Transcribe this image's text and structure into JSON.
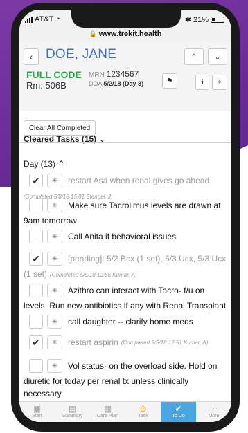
{
  "status_bar": {
    "carrier": "AT&T",
    "battery": "21%"
  },
  "browser": {
    "url": "www.trekit.health"
  },
  "patient": {
    "name": "DOE, JANE",
    "code_status": "FULL CODE",
    "room": "Rm: 506B",
    "mrn_label": "MRN",
    "mrn": "1234567",
    "doa_label": "DOA",
    "doa": "5/2/18 (Day 8)"
  },
  "actions": {
    "clear_all": "Clear All Completed"
  },
  "sections": {
    "cleared": "Cleared Tasks (15)",
    "day": "Day (13)"
  },
  "tasks": [
    {
      "checked": true,
      "done": true,
      "line1": "restart Asa when renal gives go ahead",
      "rest": "",
      "note": "(Completed 5/8/18 15:01 Stengel, J)"
    },
    {
      "checked": false,
      "done": false,
      "line1": "Make sure Tacrolimus levels are drawn at",
      "rest": "9am tomorrow",
      "note": ""
    },
    {
      "checked": false,
      "done": false,
      "line1": "Call Anita if behavioral issues",
      "rest": "",
      "note": ""
    },
    {
      "checked": true,
      "done": true,
      "line1": "[pending]: 5/2 Bcx (1 set), 5/3 Ucx, 5/3 Ucx",
      "rest": "(1 set)",
      "note": "(Completed 5/5/18 12:56 Kumar, A)"
    },
    {
      "checked": false,
      "done": false,
      "line1": "Azithro can interact with Tacro- f/u on",
      "rest": "levels. Run new antibiotics if any with Renal Transplant",
      "note": ""
    },
    {
      "checked": false,
      "done": false,
      "line1": "call daughter -- clarify home meds",
      "rest": "",
      "note": ""
    },
    {
      "checked": true,
      "done": true,
      "line1": "restart aspirin",
      "rest": "",
      "note": "(Completed 5/5/18 12:51 Kumar, A)"
    },
    {
      "checked": false,
      "done": false,
      "line1": "Vol status- on the overload side. Hold on",
      "rest": "diuretic for today per renal tx unless clinically necessary",
      "note": ""
    }
  ],
  "nav": [
    {
      "label": "Start",
      "icon": "suitcase-icon"
    },
    {
      "label": "Summary",
      "icon": "document-icon"
    },
    {
      "label": "Care Plan",
      "icon": "calendar-icon"
    },
    {
      "label": "Task",
      "icon": "plus-circle-icon"
    },
    {
      "label": "To Do",
      "icon": "check-circle-icon",
      "active": true
    },
    {
      "label": "More",
      "icon": "ellipsis-icon"
    }
  ]
}
